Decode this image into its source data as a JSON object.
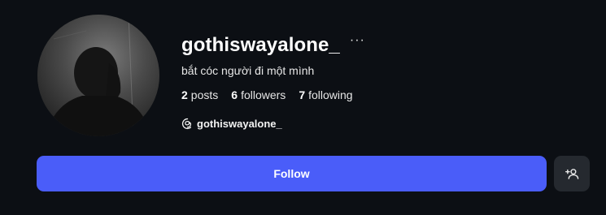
{
  "profile": {
    "username": "gothiswayalone_",
    "bio": "bắt cóc người đi một mình",
    "stats": {
      "posts_count": "2",
      "posts_label": "posts",
      "followers_count": "6",
      "followers_label": "followers",
      "following_count": "7",
      "following_label": "following"
    },
    "threads_handle": "gothiswayalone_",
    "more_label": "···"
  },
  "actions": {
    "follow_label": "Follow",
    "add_user_icon": "add-user-icon"
  },
  "colors": {
    "background": "#0c0f14",
    "follow_button": "#4a5df9",
    "secondary_button": "#25292f"
  }
}
